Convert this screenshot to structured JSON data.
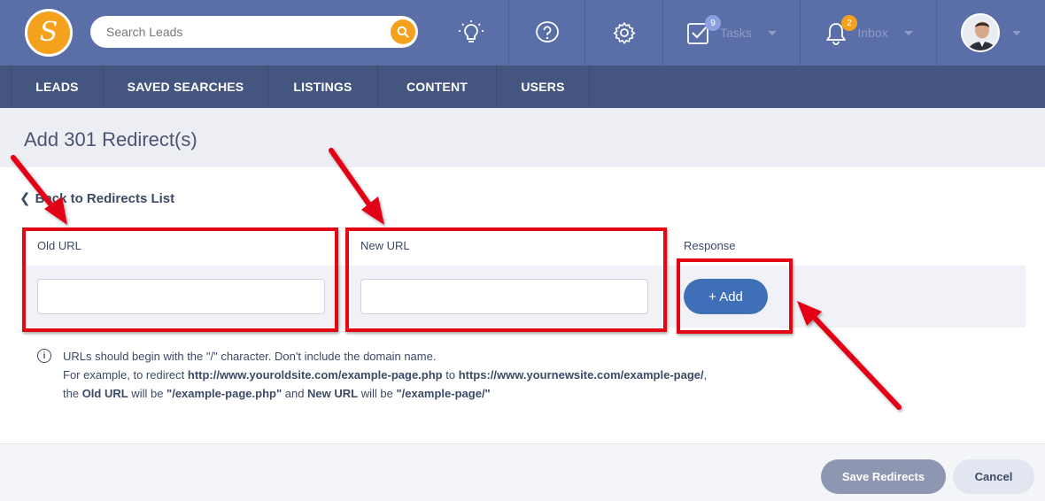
{
  "brand": {
    "logo_letter": "S",
    "accent": "#f4a11e",
    "topbar_color": "#5a6ea8",
    "subnav_color": "#44557f"
  },
  "search": {
    "placeholder": "Search Leads",
    "value": ""
  },
  "header_icons": [
    "lightbulb-icon",
    "help-icon",
    "gear-icon"
  ],
  "tasks": {
    "label": "Tasks",
    "badge": "9"
  },
  "inbox": {
    "label": "Inbox",
    "badge": "2"
  },
  "subnav": [
    {
      "label": "LEADS"
    },
    {
      "label": "SAVED SEARCHES"
    },
    {
      "label": "LISTINGS"
    },
    {
      "label": "CONTENT"
    },
    {
      "label": "USERS"
    }
  ],
  "page": {
    "title": "Add 301 Redirect(s)",
    "back_link": "Back to Redirects List"
  },
  "form": {
    "old_url_label": "Old URL",
    "new_url_label": "New URL",
    "response_label": "Response",
    "old_url_value": "",
    "new_url_value": "",
    "add_button": "+ Add"
  },
  "info": {
    "line1": "URLs should begin with the \"/\" character. Don't include the domain name.",
    "line2_a": "For example, to redirect ",
    "line2_old_site": "http://www.youroldsite.com/example-page.php",
    "line2_b": " to ",
    "line2_new_site": "https://www.yournewsite.com/example-page/",
    "line2_c": ",",
    "line3_a": "the ",
    "line3_old_label": "Old URL",
    "line3_b": " will be ",
    "line3_old_value": "\"/example-page.php\"",
    "line3_c": " and ",
    "line3_new_label": "New URL",
    "line3_d": " will be ",
    "line3_new_value": "\"/example-page/\""
  },
  "footer": {
    "save_button": "Save Redirects",
    "cancel_button": "Cancel"
  },
  "annotation_color": "#e30613"
}
